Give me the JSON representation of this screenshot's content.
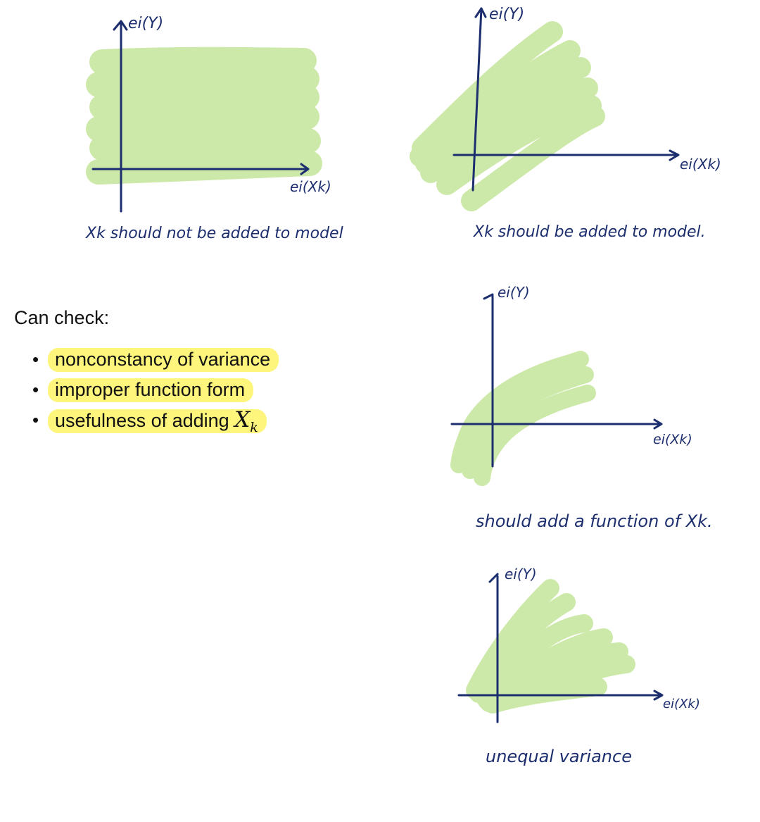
{
  "colors": {
    "ink": "#1c2e6e",
    "marker": "#cde9a9",
    "highlight": "#fdf57c"
  },
  "sketches": [
    {
      "y_label": "ei(Y)",
      "x_label": "ei(Xk)",
      "caption": "Xk should not be added to model"
    },
    {
      "y_label": "ei(Y)",
      "x_label": "ei(Xk)",
      "caption": "Xk should be added to model."
    },
    {
      "y_label": "ei(Y)",
      "x_label": "ei(Xk)",
      "caption": "should add a function of Xk."
    },
    {
      "y_label": "ei(Y)",
      "x_label": "ei(Xk)",
      "caption": "unequal variance"
    }
  ],
  "checklist": {
    "heading": "Can check:",
    "items": [
      {
        "text": "nonconstancy of variance"
      },
      {
        "text": "improper function form"
      },
      {
        "text": "usefulness of adding ",
        "math": "X",
        "math_sub": "k"
      }
    ]
  }
}
